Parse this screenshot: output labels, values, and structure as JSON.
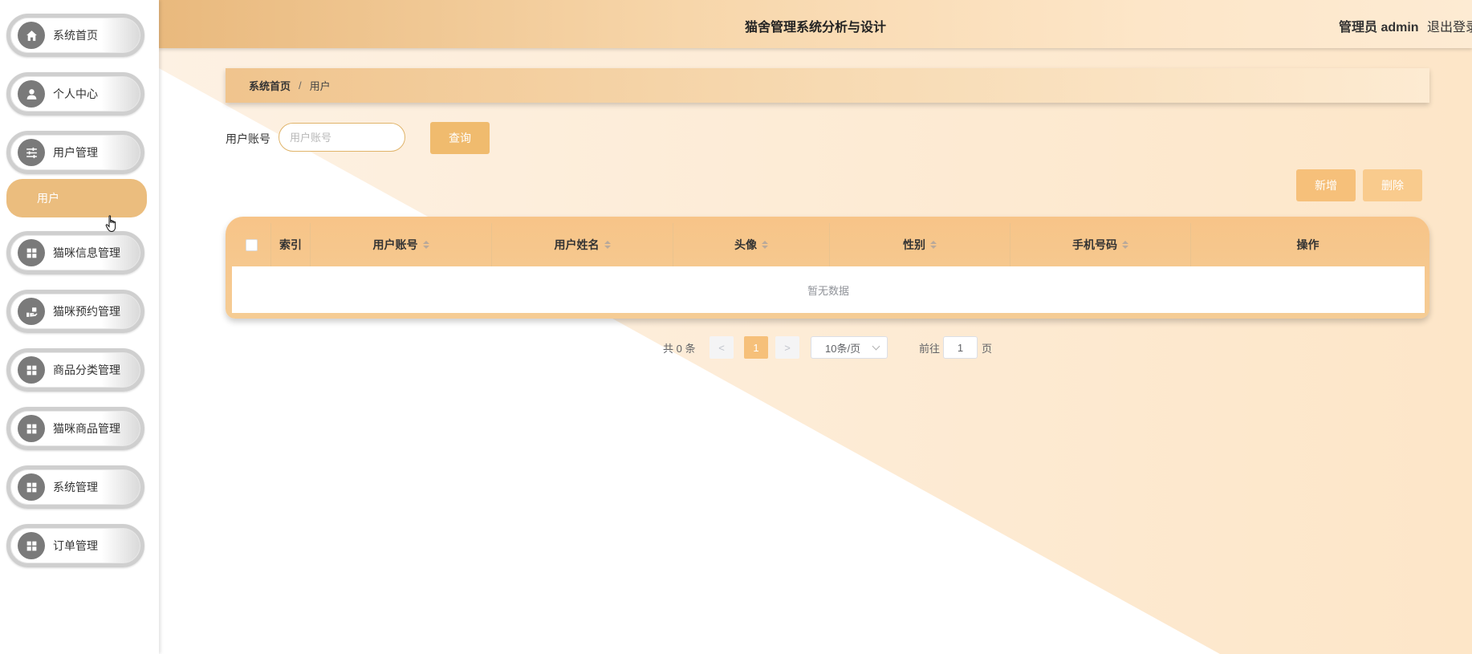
{
  "app": {
    "title": "猫舍管理系统分析与设计",
    "admin_label": "管理员 admin",
    "logout_label": "退出登录"
  },
  "sidebar": {
    "items": [
      {
        "label": "系统首页",
        "icon": "home-icon"
      },
      {
        "label": "个人中心",
        "icon": "user-icon"
      },
      {
        "label": "用户管理",
        "icon": "sliders-icon"
      },
      {
        "label": "猫咪信息管理",
        "icon": "grid-icon"
      },
      {
        "label": "猫咪预约管理",
        "icon": "hand-icon"
      },
      {
        "label": "商品分类管理",
        "icon": "grid-icon"
      },
      {
        "label": "猫咪商品管理",
        "icon": "grid-icon"
      },
      {
        "label": "系统管理",
        "icon": "grid-icon"
      },
      {
        "label": "订单管理",
        "icon": "grid-icon"
      }
    ],
    "active_submenu": "用户"
  },
  "breadcrumb": {
    "home": "系统首页",
    "separator": "/",
    "current": "用户"
  },
  "search": {
    "label": "用户账号",
    "placeholder": "用户账号",
    "button": "查询"
  },
  "actions": {
    "add": "新增",
    "delete": "删除"
  },
  "table": {
    "columns": [
      "索引",
      "用户账号",
      "用户姓名",
      "头像",
      "性别",
      "手机号码",
      "操作"
    ],
    "empty_text": "暂无数据"
  },
  "pagination": {
    "total": "共 0 条",
    "prev": "<",
    "page": "1",
    "next": ">",
    "page_size": "10条/页",
    "goto_prefix": "前往",
    "goto_value": "1",
    "goto_suffix": "页"
  },
  "colors": {
    "accent": "#f6c07a",
    "active_submenu": "#ebbd7e",
    "icon_bg": "#7a7a7a"
  }
}
